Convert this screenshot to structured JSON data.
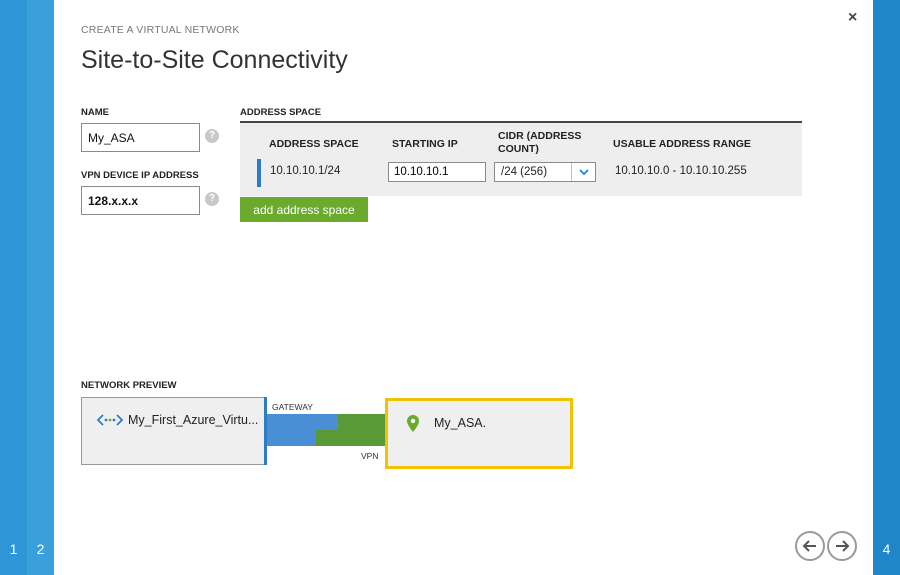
{
  "steps": {
    "step1": "1",
    "step2": "2",
    "step4": "4"
  },
  "close_glyph": "×",
  "header": {
    "subtitle": "CREATE A VIRTUAL NETWORK",
    "title": "Site-to-Site Connectivity"
  },
  "form": {
    "name_label": "NAME",
    "name_value": "My_ASA",
    "vpn_label": "VPN DEVICE IP ADDRESS",
    "vpn_value": "128.x.x.x",
    "help_glyph": "?"
  },
  "address_space": {
    "section_label": "ADDRESS SPACE",
    "columns": [
      "ADDRESS SPACE",
      "STARTING IP",
      "CIDR (ADDRESS COUNT)",
      "USABLE ADDRESS RANGE"
    ],
    "rows": [
      {
        "address_space": "10.10.10.1/24",
        "starting_ip": "10.10.10.1",
        "cidr": "/24 (256)",
        "usable_range": "10.10.10.0 - 10.10.10.255"
      }
    ],
    "add_button": "add address space"
  },
  "preview": {
    "label": "NETWORK PREVIEW",
    "network_name": "My_First_Azure_Virtu...",
    "gateway_label": "GATEWAY",
    "vpn_label": "VPN",
    "site_name": "My_ASA.",
    "colors": {
      "azure_blue": "#4a8fd6",
      "vpn_green": "#5a9a36",
      "site_border": "#f2c200"
    }
  },
  "icons": {
    "vnet": "virtual-network-icon",
    "site": "location-pin-icon",
    "back": "arrow-left-icon",
    "next": "arrow-right-icon",
    "dropdown": "chevron-down-icon"
  },
  "colors": {
    "rail": "#2e96d6",
    "accent_green": "#6aaa2c"
  }
}
